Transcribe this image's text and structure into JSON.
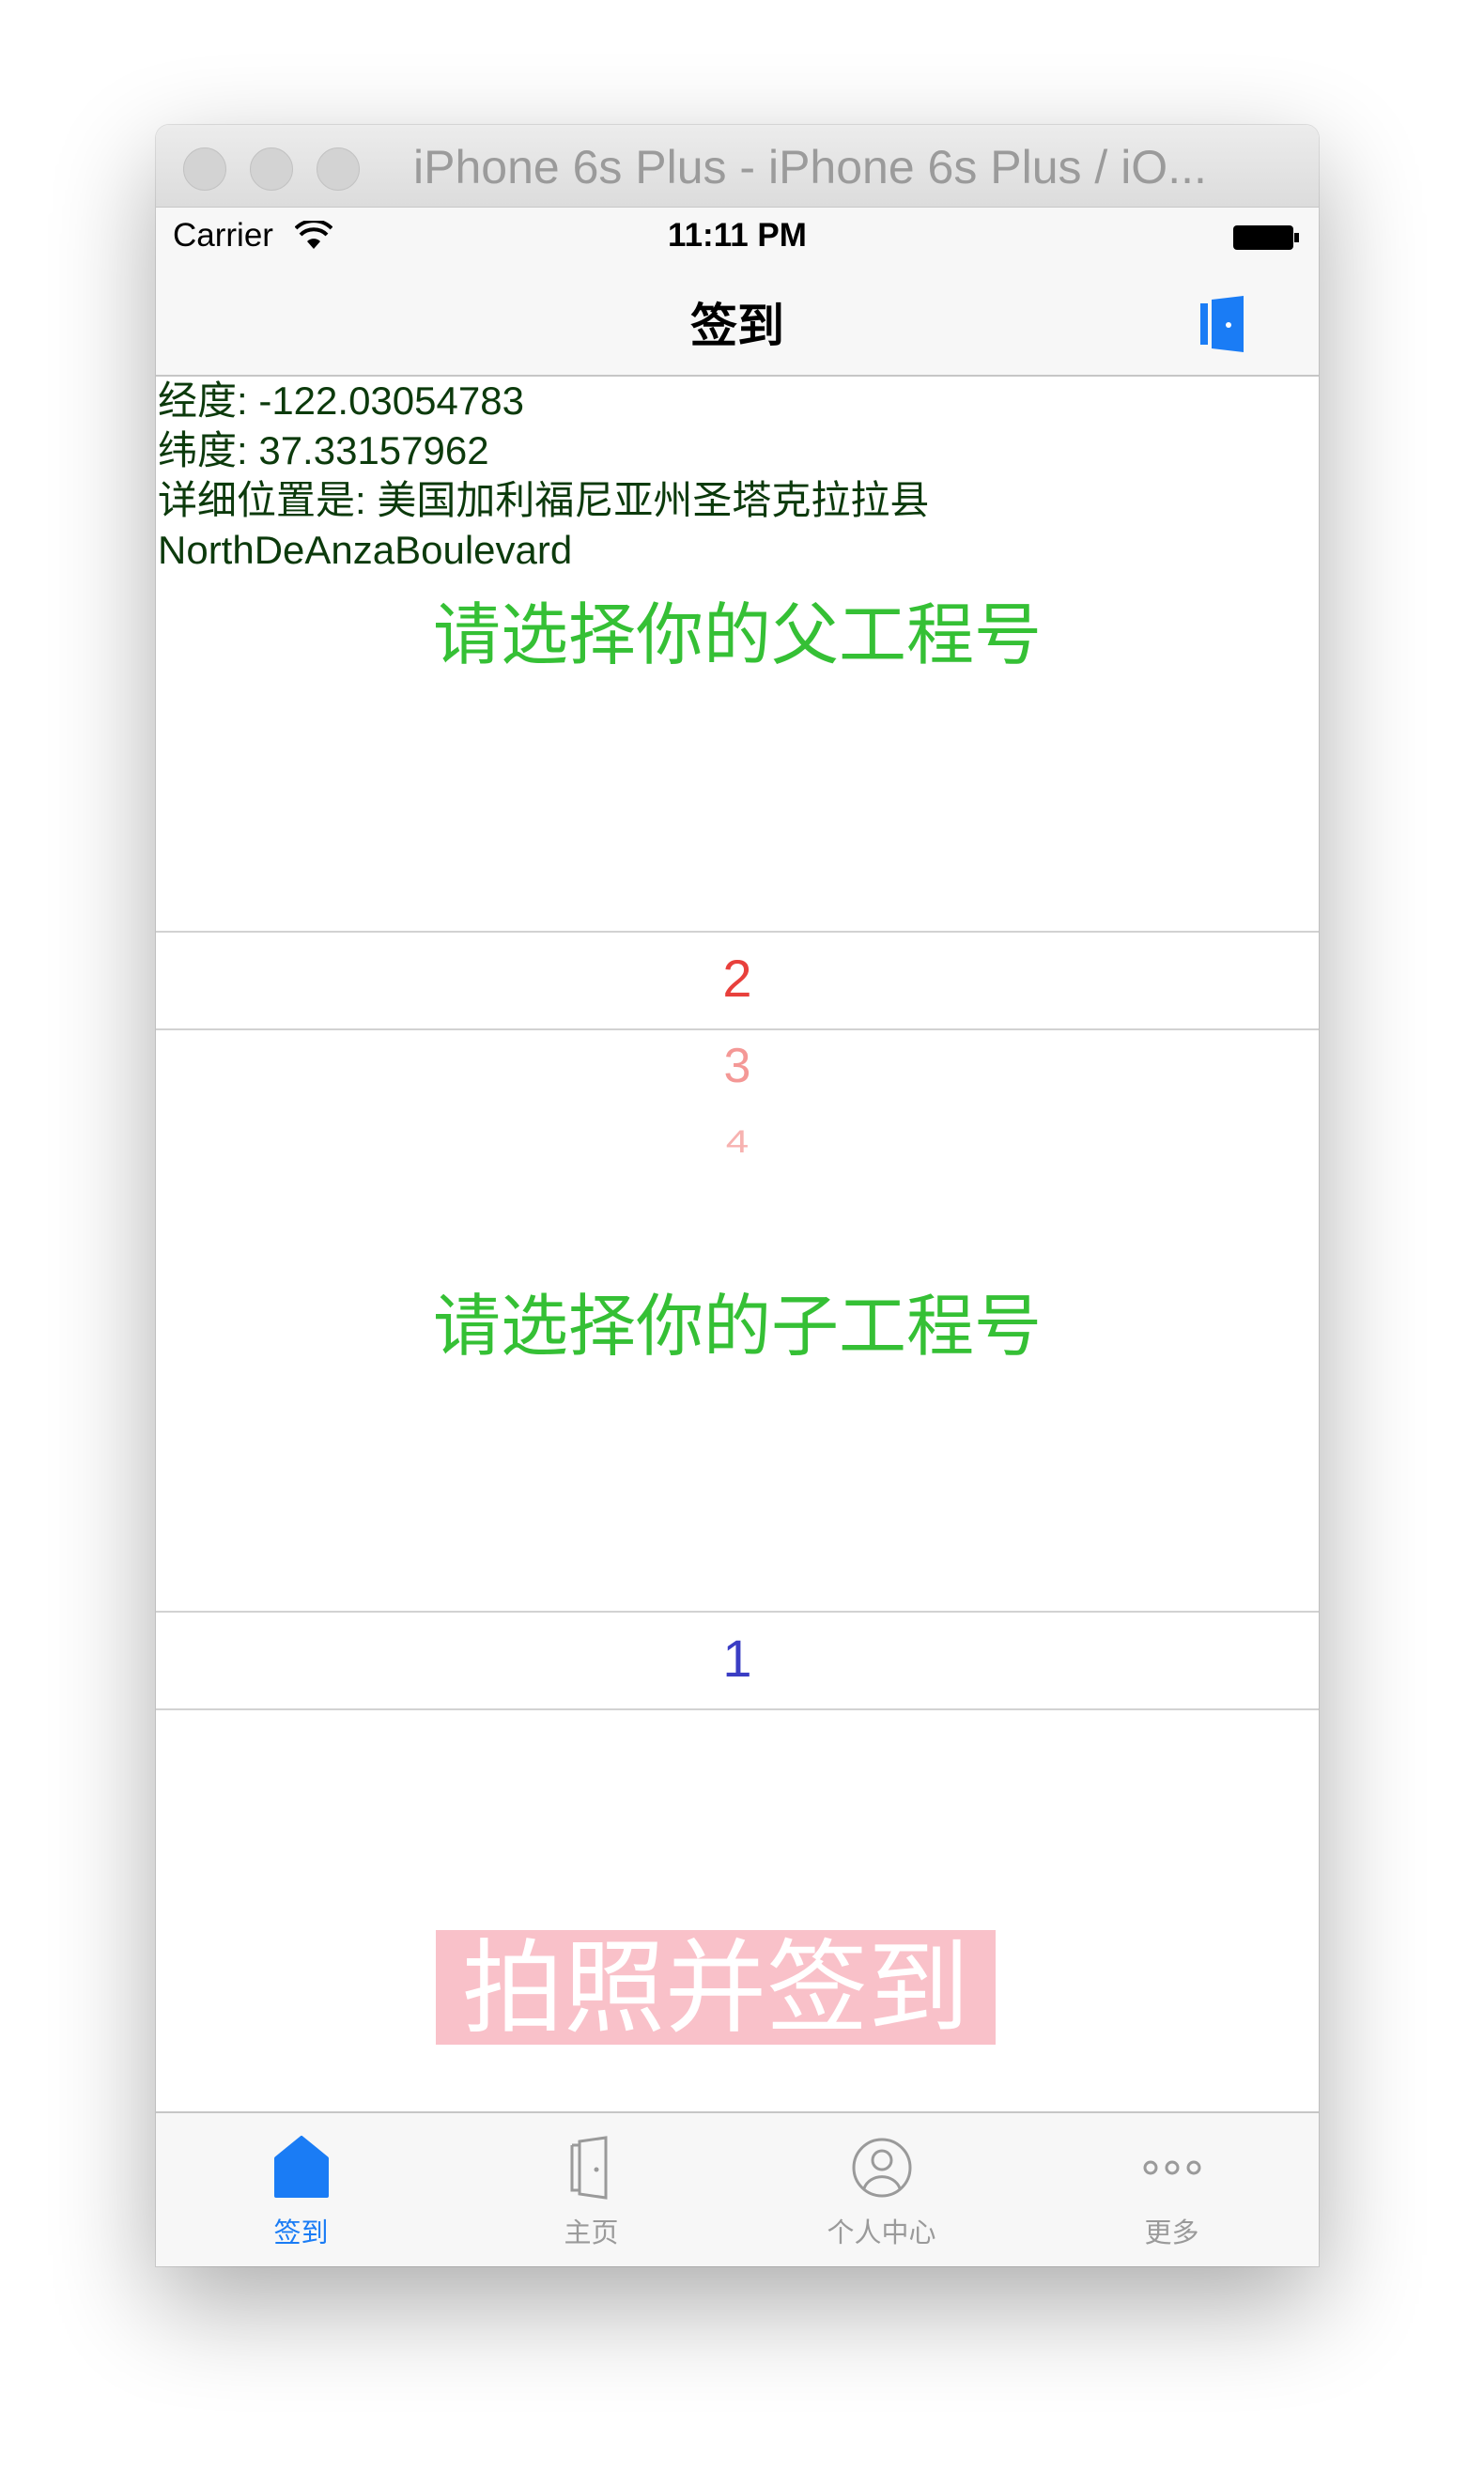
{
  "window": {
    "title": "iPhone 6s Plus - iPhone 6s Plus / iO..."
  },
  "statusbar": {
    "carrier": "Carrier",
    "time": "11:11 PM"
  },
  "navbar": {
    "title": "签到",
    "right_icon": "exit-door-icon"
  },
  "location": {
    "longitude": "经度: -122.03054783",
    "latitude": "纬度: 37.33157962",
    "address_line1": "详细位置是: 美国加利福尼亚州圣塔克拉拉县",
    "address_line2": "NorthDeAnzaBoulevard"
  },
  "parent_picker": {
    "title": "请选择你的父工程号",
    "selected": "2",
    "options_below": [
      "3",
      "4"
    ]
  },
  "child_picker": {
    "title": "请选择你的子工程号",
    "selected": "1"
  },
  "actions": {
    "sign_button": "拍照并签到"
  },
  "tabbar": {
    "items": [
      {
        "label": "签到",
        "icon": "house-icon",
        "active": true
      },
      {
        "label": "主页",
        "icon": "door-icon",
        "active": false
      },
      {
        "label": "个人中心",
        "icon": "person-icon",
        "active": false
      },
      {
        "label": "更多",
        "icon": "more-dots-icon",
        "active": false
      }
    ]
  },
  "colors": {
    "accent": "#1a7cf5",
    "section_title": "#35c035",
    "picker_selected_parent": "#e8403c",
    "picker_unselected_parent": "#f49896",
    "picker_selected_child": "#3a3dc4",
    "sign_button_bg": "#f9c1c9",
    "info_text": "#0c3a0c"
  }
}
